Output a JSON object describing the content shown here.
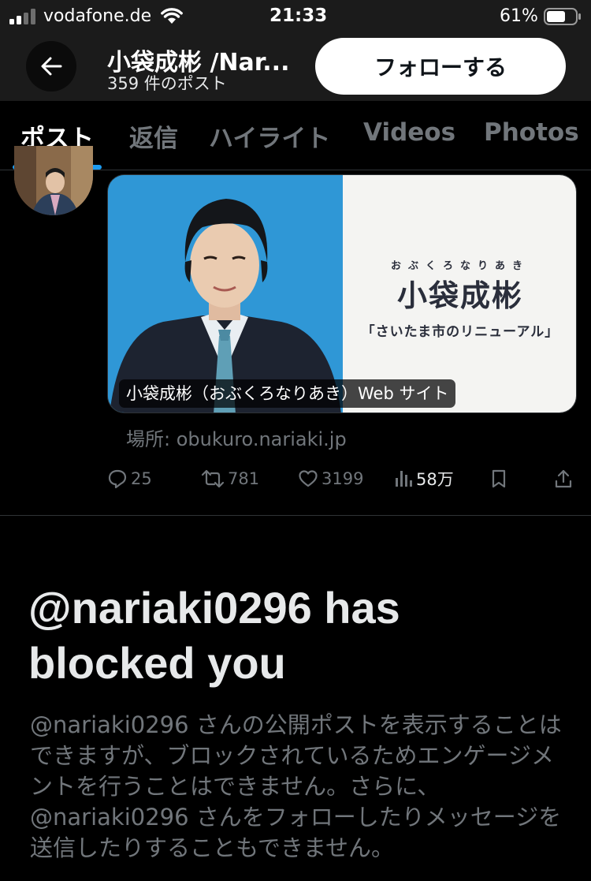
{
  "status_bar": {
    "carrier": "vodafone.de",
    "time": "21:33",
    "battery": "61%"
  },
  "header": {
    "title": "小袋成彬 /Nar...",
    "post_count": "359 件のポスト",
    "follow_label": "フォローする"
  },
  "tabs": [
    {
      "label": "ポスト",
      "active": true
    },
    {
      "label": "返信",
      "active": false
    },
    {
      "label": "ハイライト",
      "active": false
    },
    {
      "label": "Videos",
      "active": false
    },
    {
      "label": "Photos",
      "active": false
    }
  ],
  "post": {
    "card": {
      "ruby": "おぶくろなりあき",
      "name": "小袋成彬",
      "tagline": "「さいたま市のリニューアル」",
      "caption": "小袋成彬（おぶくろなりあき）Web サイト"
    },
    "location": "場所: obukuro.nariaki.jp",
    "stats": {
      "replies": "25",
      "reposts": "781",
      "likes": "3199",
      "views": "58万"
    }
  },
  "blocked": {
    "title": "@nariaki0296 has blocked you",
    "description": "@nariaki0296 さんの公開ポストを表示することはできますが、ブロックされているためエンゲージメントを行うことはできません。さらに、@nariaki0296 さんをフォローしたりメッセージを送信したりすることもできません。"
  }
}
